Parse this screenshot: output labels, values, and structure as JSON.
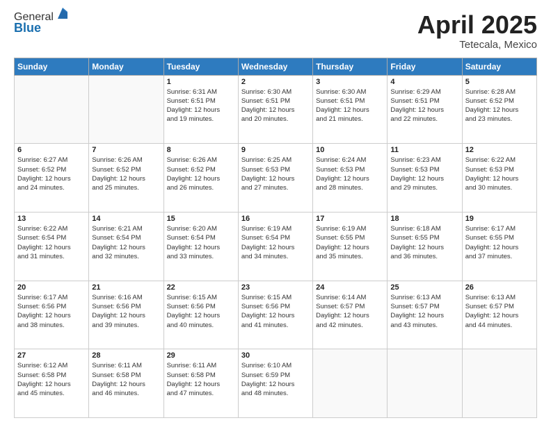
{
  "header": {
    "logo_general": "General",
    "logo_blue": "Blue",
    "title": "April 2025",
    "location": "Tetecala, Mexico"
  },
  "days_of_week": [
    "Sunday",
    "Monday",
    "Tuesday",
    "Wednesday",
    "Thursday",
    "Friday",
    "Saturday"
  ],
  "weeks": [
    [
      {
        "day": "",
        "info": ""
      },
      {
        "day": "",
        "info": ""
      },
      {
        "day": "1",
        "info": "Sunrise: 6:31 AM\nSunset: 6:51 PM\nDaylight: 12 hours\nand 19 minutes."
      },
      {
        "day": "2",
        "info": "Sunrise: 6:30 AM\nSunset: 6:51 PM\nDaylight: 12 hours\nand 20 minutes."
      },
      {
        "day": "3",
        "info": "Sunrise: 6:30 AM\nSunset: 6:51 PM\nDaylight: 12 hours\nand 21 minutes."
      },
      {
        "day": "4",
        "info": "Sunrise: 6:29 AM\nSunset: 6:51 PM\nDaylight: 12 hours\nand 22 minutes."
      },
      {
        "day": "5",
        "info": "Sunrise: 6:28 AM\nSunset: 6:52 PM\nDaylight: 12 hours\nand 23 minutes."
      }
    ],
    [
      {
        "day": "6",
        "info": "Sunrise: 6:27 AM\nSunset: 6:52 PM\nDaylight: 12 hours\nand 24 minutes."
      },
      {
        "day": "7",
        "info": "Sunrise: 6:26 AM\nSunset: 6:52 PM\nDaylight: 12 hours\nand 25 minutes."
      },
      {
        "day": "8",
        "info": "Sunrise: 6:26 AM\nSunset: 6:52 PM\nDaylight: 12 hours\nand 26 minutes."
      },
      {
        "day": "9",
        "info": "Sunrise: 6:25 AM\nSunset: 6:53 PM\nDaylight: 12 hours\nand 27 minutes."
      },
      {
        "day": "10",
        "info": "Sunrise: 6:24 AM\nSunset: 6:53 PM\nDaylight: 12 hours\nand 28 minutes."
      },
      {
        "day": "11",
        "info": "Sunrise: 6:23 AM\nSunset: 6:53 PM\nDaylight: 12 hours\nand 29 minutes."
      },
      {
        "day": "12",
        "info": "Sunrise: 6:22 AM\nSunset: 6:53 PM\nDaylight: 12 hours\nand 30 minutes."
      }
    ],
    [
      {
        "day": "13",
        "info": "Sunrise: 6:22 AM\nSunset: 6:54 PM\nDaylight: 12 hours\nand 31 minutes."
      },
      {
        "day": "14",
        "info": "Sunrise: 6:21 AM\nSunset: 6:54 PM\nDaylight: 12 hours\nand 32 minutes."
      },
      {
        "day": "15",
        "info": "Sunrise: 6:20 AM\nSunset: 6:54 PM\nDaylight: 12 hours\nand 33 minutes."
      },
      {
        "day": "16",
        "info": "Sunrise: 6:19 AM\nSunset: 6:54 PM\nDaylight: 12 hours\nand 34 minutes."
      },
      {
        "day": "17",
        "info": "Sunrise: 6:19 AM\nSunset: 6:55 PM\nDaylight: 12 hours\nand 35 minutes."
      },
      {
        "day": "18",
        "info": "Sunrise: 6:18 AM\nSunset: 6:55 PM\nDaylight: 12 hours\nand 36 minutes."
      },
      {
        "day": "19",
        "info": "Sunrise: 6:17 AM\nSunset: 6:55 PM\nDaylight: 12 hours\nand 37 minutes."
      }
    ],
    [
      {
        "day": "20",
        "info": "Sunrise: 6:17 AM\nSunset: 6:56 PM\nDaylight: 12 hours\nand 38 minutes."
      },
      {
        "day": "21",
        "info": "Sunrise: 6:16 AM\nSunset: 6:56 PM\nDaylight: 12 hours\nand 39 minutes."
      },
      {
        "day": "22",
        "info": "Sunrise: 6:15 AM\nSunset: 6:56 PM\nDaylight: 12 hours\nand 40 minutes."
      },
      {
        "day": "23",
        "info": "Sunrise: 6:15 AM\nSunset: 6:56 PM\nDaylight: 12 hours\nand 41 minutes."
      },
      {
        "day": "24",
        "info": "Sunrise: 6:14 AM\nSunset: 6:57 PM\nDaylight: 12 hours\nand 42 minutes."
      },
      {
        "day": "25",
        "info": "Sunrise: 6:13 AM\nSunset: 6:57 PM\nDaylight: 12 hours\nand 43 minutes."
      },
      {
        "day": "26",
        "info": "Sunrise: 6:13 AM\nSunset: 6:57 PM\nDaylight: 12 hours\nand 44 minutes."
      }
    ],
    [
      {
        "day": "27",
        "info": "Sunrise: 6:12 AM\nSunset: 6:58 PM\nDaylight: 12 hours\nand 45 minutes."
      },
      {
        "day": "28",
        "info": "Sunrise: 6:11 AM\nSunset: 6:58 PM\nDaylight: 12 hours\nand 46 minutes."
      },
      {
        "day": "29",
        "info": "Sunrise: 6:11 AM\nSunset: 6:58 PM\nDaylight: 12 hours\nand 47 minutes."
      },
      {
        "day": "30",
        "info": "Sunrise: 6:10 AM\nSunset: 6:59 PM\nDaylight: 12 hours\nand 48 minutes."
      },
      {
        "day": "",
        "info": ""
      },
      {
        "day": "",
        "info": ""
      },
      {
        "day": "",
        "info": ""
      }
    ]
  ]
}
